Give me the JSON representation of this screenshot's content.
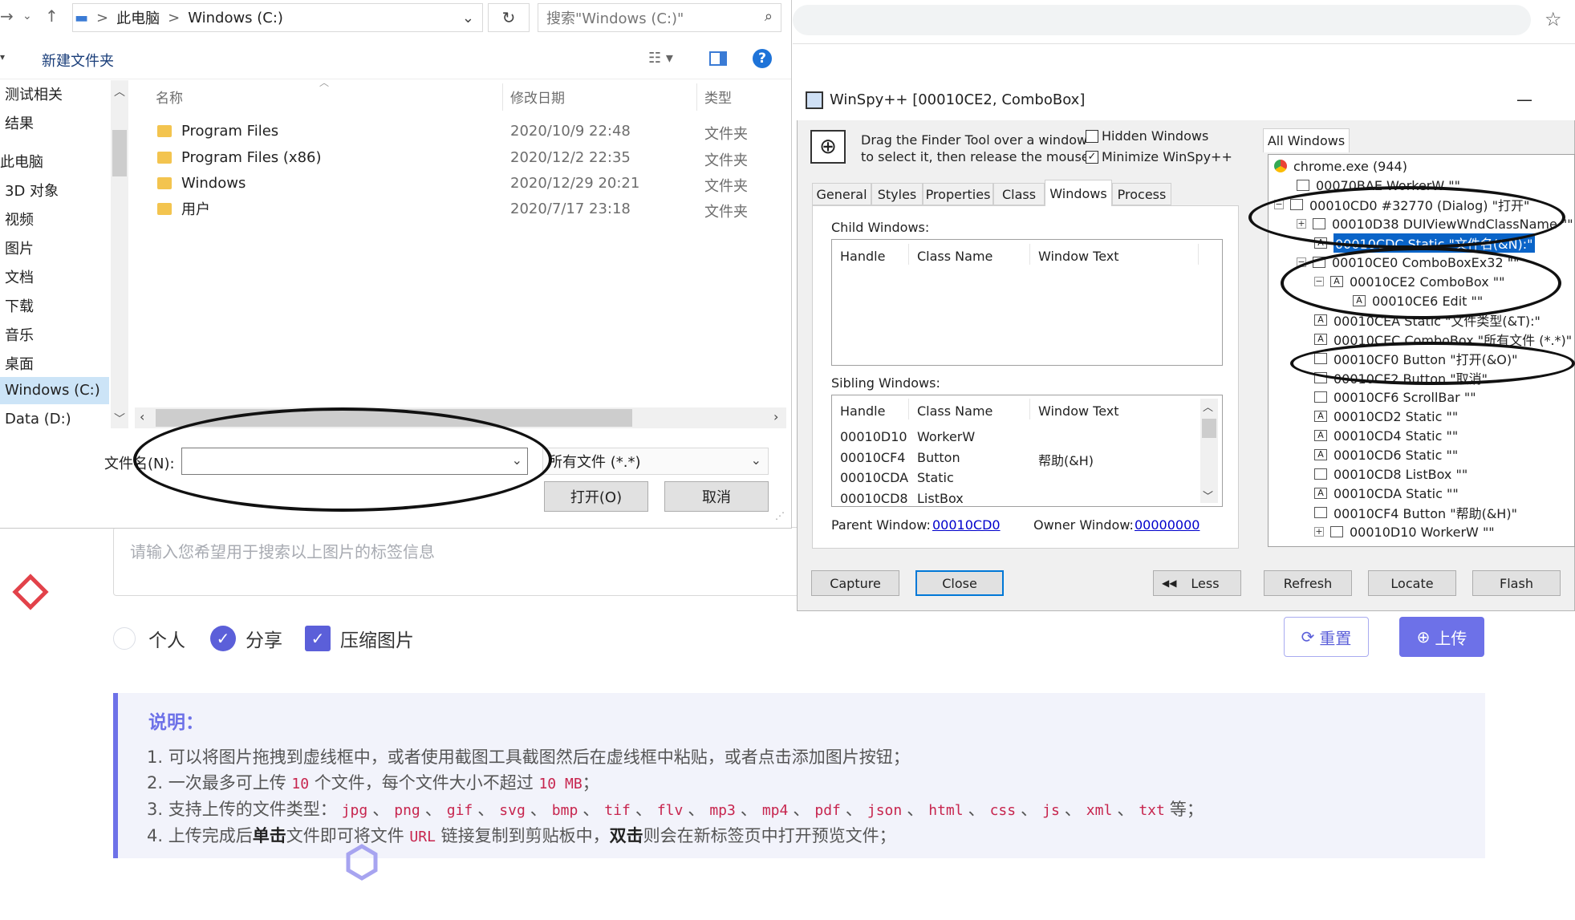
{
  "web": {
    "tag_placeholder": "请输入您希望用于搜索以上图片的标签信息",
    "options": {
      "personal": "个人",
      "share": "分享",
      "compress": "压缩图片"
    },
    "reset_label": "重置",
    "upload_label": "上传",
    "notes": {
      "title": "说明：",
      "line1": "1. 可以将图片拖拽到虚线框中，或者使用截图工具截图然后在虚线框中粘贴，或者点击添加图片按钮；",
      "line2_a": "2. 一次最多可上传",
      "line2_n1": "10",
      "line2_b": "个文件，每个文件大小不超过",
      "line2_n2": "10 MB",
      "line2_c": "；",
      "line3_a": "3. 支持上传的文件类型：",
      "file_types": [
        "jpg",
        "png",
        "gif",
        "svg",
        "bmp",
        "tif",
        "flv",
        "mp3",
        "mp4",
        "pdf",
        "json",
        "html",
        "css",
        "js",
        "xml",
        "txt"
      ],
      "line3_sep": "、",
      "line3_c": "等；",
      "line4_a": "4. 上传完成后",
      "line4_b1": "单击",
      "line4_c": "文件即可将文件",
      "line4_url": "URL",
      "line4_d": "链接复制到剪贴板中，",
      "line4_b2": "双击",
      "line4_e": "则会在新标签页中打开预览文件；"
    },
    "colors": {
      "accent": "#6d71e8",
      "code": "#c7254e",
      "diamond": "#e2424a"
    }
  },
  "file_dialog": {
    "breadcrumb": {
      "root": "此电脑",
      "sep": ">",
      "drive": "Windows (C:)"
    },
    "search_placeholder": "搜索\"Windows (C:)\"",
    "new_folder": "新建文件夹",
    "nav_items": [
      "测试相关",
      "结果",
      "此电脑",
      "3D 对象",
      "视频",
      "图片",
      "文档",
      "下载",
      "音乐",
      "桌面",
      "Windows (C:)",
      "Data (D:)"
    ],
    "columns": {
      "name": "名称",
      "date": "修改日期",
      "type": "类型"
    },
    "files": [
      {
        "name": "Program Files",
        "date": "2020/10/9 22:48",
        "type": "文件夹"
      },
      {
        "name": "Program Files (x86)",
        "date": "2020/12/2 22:35",
        "type": "文件夹"
      },
      {
        "name": "Windows",
        "date": "2020/12/29 20:21",
        "type": "文件夹"
      },
      {
        "name": "用户",
        "date": "2020/7/17 23:18",
        "type": "文件夹"
      }
    ],
    "filename_label": "文件名(N):",
    "filename_value": "",
    "filetype_value": "所有文件 (*.*)",
    "open_label": "打开(O)",
    "cancel_label": "取消"
  },
  "winspy": {
    "title": "WinSpy++ [00010CE2, ComboBox]",
    "finder_line1": "Drag the Finder Tool over a window",
    "finder_line2": "to select it, then release the mouse",
    "hidden_windows": "Hidden Windows",
    "minimize": "Minimize WinSpy++",
    "tabs": [
      "General",
      "Styles",
      "Properties",
      "Class",
      "Windows",
      "Process"
    ],
    "child_label": "Child Windows:",
    "sibling_label": "Sibling Windows:",
    "list_headers": {
      "handle": "Handle",
      "class": "Class Name",
      "text": "Window Text"
    },
    "siblings": [
      {
        "handle": "00010D10",
        "class": "WorkerW",
        "text": ""
      },
      {
        "handle": "00010CF4",
        "class": "Button",
        "text": "帮助(&H)"
      },
      {
        "handle": "00010CDA",
        "class": "Static",
        "text": ""
      },
      {
        "handle": "00010CD8",
        "class": "ListBox",
        "text": ""
      }
    ],
    "parent_label": "Parent Window:",
    "parent_value": "00010CD0",
    "owner_label": "Owner Window:",
    "owner_value": "00000000",
    "buttons": {
      "capture": "Capture",
      "close": "Close",
      "less": "Less",
      "refresh": "Refresh",
      "locate": "Locate",
      "flash": "Flash"
    },
    "tree_tab": "All Windows",
    "tree": [
      "chrome.exe (944)",
      "00070BAE  WorkerW  \"\"",
      "00010CD0  #32770 (Dialog)  \"打开\"",
      "00010D38  DUIViewWndClassName  \"\"",
      "00010CDC  Static  \"文件名(&N):\"",
      "00010CE0  ComboBoxEx32  \"\"",
      "00010CE2  ComboBox  \"\"",
      "00010CE6  Edit  \"\"",
      "00010CEA  Static  \"文件类型(&T):\"",
      "00010CEC  ComboBox  \"所有文件 (*.*)\"",
      "00010CF0  Button  \"打开(&O)\"",
      "00010CF2  Button  \"取消\"",
      "00010CF6  ScrollBar  \"\"",
      "00010CD2  Static  \"\"",
      "00010CD4  Static  \"\"",
      "00010CD6  Static  \"\"",
      "00010CD8  ListBox  \"\"",
      "00010CDA  Static  \"\"",
      "00010CF4  Button  \"帮助(&H)\"",
      "00010D10  WorkerW  \"\""
    ]
  }
}
